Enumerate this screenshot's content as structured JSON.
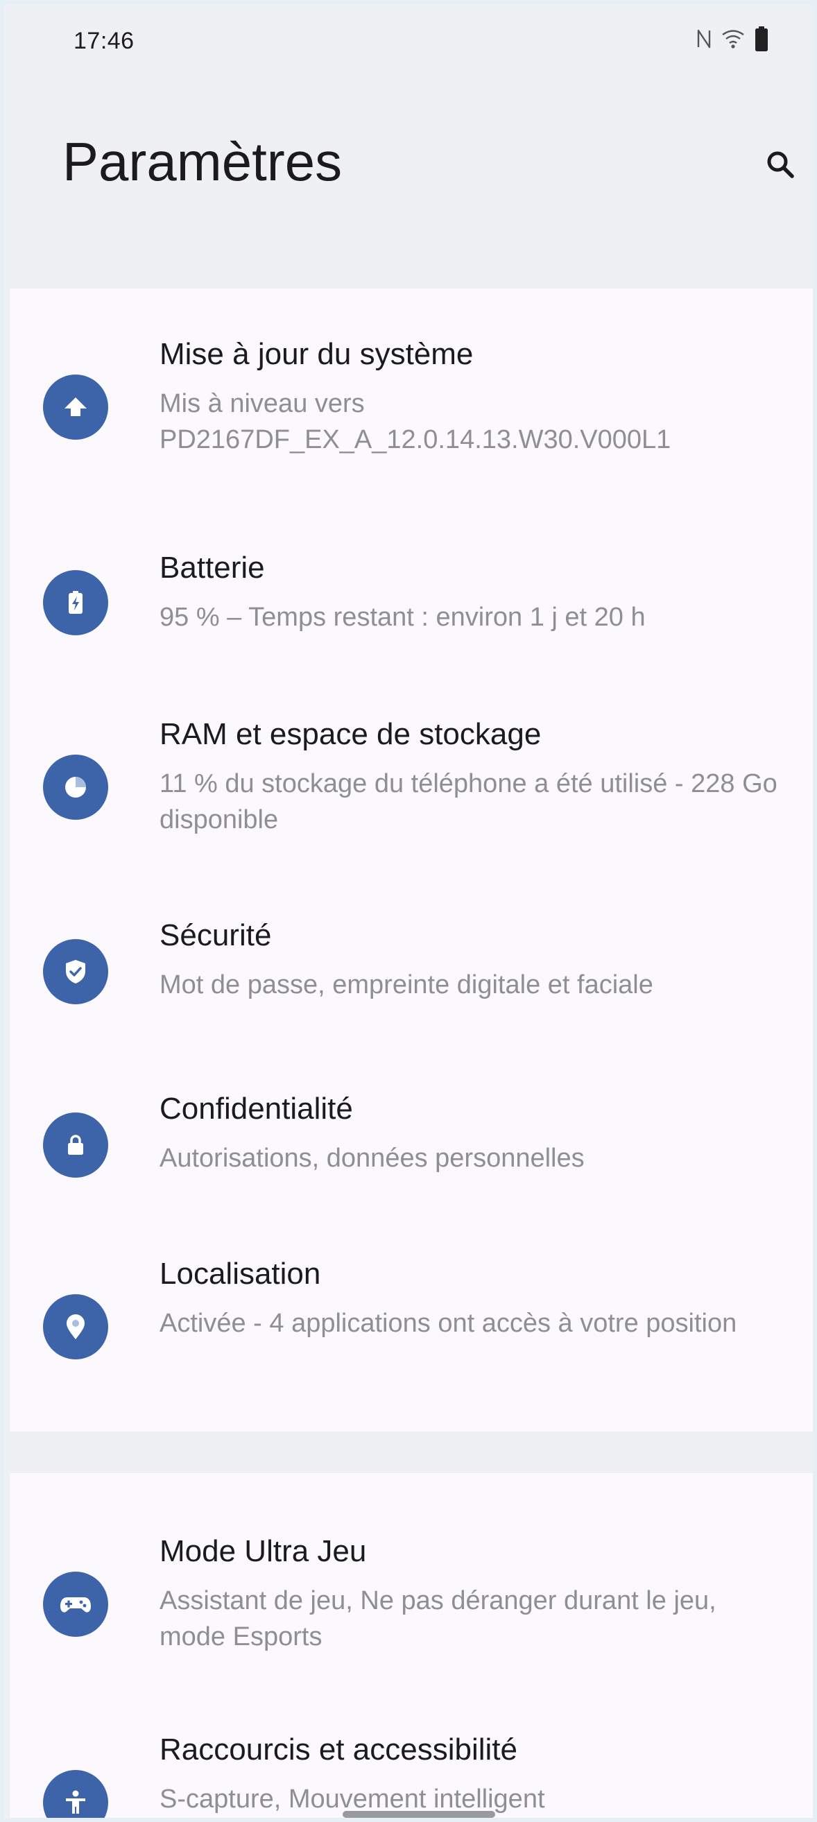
{
  "status_bar": {
    "time": "17:46",
    "icons": [
      "nfc-icon",
      "wifi-icon",
      "battery-icon"
    ]
  },
  "header": {
    "title": "Paramètres",
    "search_icon": "search-icon"
  },
  "colors": {
    "accent": "#3d64a8",
    "background": "#eef0f4",
    "card": "#fbf9fd",
    "title_text": "#1b1b1f",
    "subtitle_text": "#8e8e93"
  },
  "settings": {
    "group1": [
      {
        "title": "Mise à jour du système",
        "subtitle": "Mis à niveau vers PD2167DF_EX_A_12.0.14.13.W30.V000L1",
        "icon": "upload-arrow-icon"
      },
      {
        "title": "Batterie",
        "subtitle": "95 % – Temps restant : environ 1 j et 20 h",
        "icon": "battery-charging-icon"
      },
      {
        "title": "RAM et espace de stockage",
        "subtitle": "11 % du stockage du téléphone a été utilisé - 228 Go disponible",
        "icon": "pie-chart-icon"
      },
      {
        "title": "Sécurité",
        "subtitle": "Mot de passe, empreinte digitale et faciale",
        "icon": "shield-check-icon"
      },
      {
        "title": "Confidentialité",
        "subtitle": "Autorisations, données personnelles",
        "icon": "lock-icon"
      },
      {
        "title": "Localisation",
        "subtitle": "Activée - 4 applications ont accès à votre position",
        "icon": "location-pin-icon"
      }
    ],
    "group2": [
      {
        "title": "Mode Ultra Jeu",
        "subtitle": "Assistant de jeu, Ne pas déranger durant le jeu, mode Esports",
        "icon": "gamepad-icon"
      },
      {
        "title": "Raccourcis et accessibilité",
        "subtitle": "S-capture, Mouvement intelligent",
        "icon": "accessibility-icon"
      }
    ]
  }
}
